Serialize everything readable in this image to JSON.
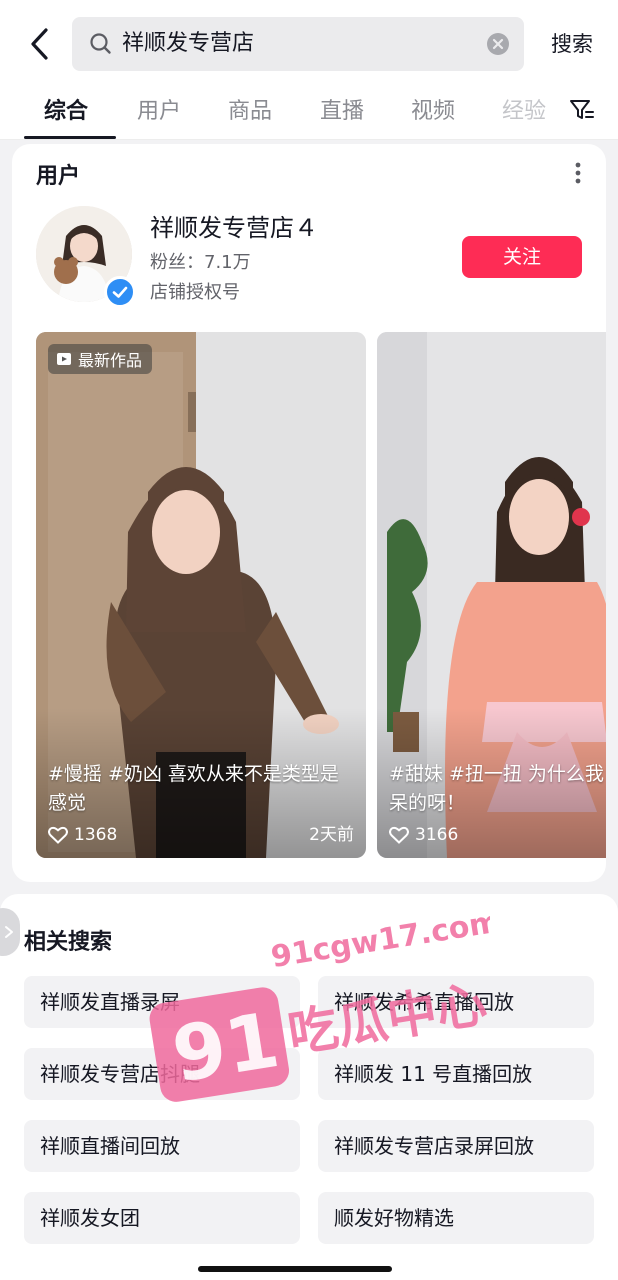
{
  "search": {
    "query": "祥顺发专营店",
    "button_label": "搜索"
  },
  "tabs": [
    {
      "label": "综合",
      "active": true
    },
    {
      "label": "用户",
      "active": false
    },
    {
      "label": "商品",
      "active": false
    },
    {
      "label": "直播",
      "active": false
    },
    {
      "label": "视频",
      "active": false
    },
    {
      "label": "经验",
      "active": false
    }
  ],
  "user_section": {
    "title": "用户",
    "user": {
      "name": "祥顺发专营店４",
      "fans": "粉丝：7.1万",
      "account_type": "店铺授权号",
      "verified": true
    },
    "follow_label": "关注"
  },
  "videos": [
    {
      "badge": "最新作品",
      "caption": "#慢摇 #奶凶 喜欢从来不是类型是感觉",
      "likes": "1368",
      "time_ago": "2天前"
    },
    {
      "caption": "#甜妹 #扭一扭 为什么我",
      "caption_line2": "呆的呀！",
      "likes": "3166"
    }
  ],
  "related": {
    "title": "相关搜索",
    "items": [
      "祥顺发直播录屏",
      "祥顺发希希直播回放",
      "祥顺发专营店抖腿",
      "祥顺发 11 号直播回放",
      "祥顺直播间回放",
      "祥顺发专营店录屏回放",
      "祥顺发女团",
      "顺发好物精选"
    ]
  },
  "watermark": {
    "url": "91cgw17.com",
    "number": "91",
    "text": "吃瓜中心"
  },
  "colors": {
    "accent": "#fe2c55",
    "verified": "#2e8ef5",
    "text_primary": "#161823",
    "text_secondary": "#62636a",
    "watermark_pink": "#f06a9c"
  }
}
